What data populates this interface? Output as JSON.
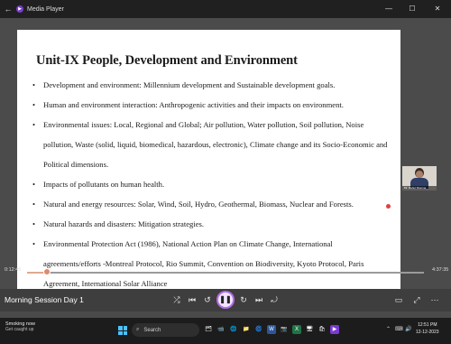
{
  "window": {
    "title": "Media Player",
    "back_glyph": "←",
    "app_icon_glyph": "▶",
    "minimize_glyph": "—",
    "maximize_glyph": "☐",
    "close_glyph": "✕"
  },
  "slide": {
    "title": "Unit-IX People, Development and Environment",
    "bullets": [
      "Development and environment: Millennium development and Sustainable development goals.",
      "Human and environment interaction: Anthropogenic activities and their impacts on environment.",
      "Environmental issues: Local, Regional and Global; Air pollution, Water pollution, Soil pollution, Noise pollution, Waste (solid, liquid, biomedical, hazardous, electronic), Climate change and its Socio-Economic and Political dimensions.",
      "Impacts of pollutants on human health.",
      "Natural and energy resources: Solar, Wind, Soil, Hydro, Geothermal, Biomass, Nuclear and Forests.",
      "Natural hazards and disasters: Mitigation strategies.",
      "Environmental Protection Act (1986), National Action Plan on Climate Change, International agreements/efforts -Montreal Protocol, Rio Summit, Convention on Biodiversity, Kyoto Protocol, Paris Agreement, International Solar Alliance"
    ]
  },
  "webcam": {
    "caption": "Mr. Rahul Sharma"
  },
  "player": {
    "elapsed": "0:12:45",
    "total": "4:37:35",
    "progress_fraction": 0.05,
    "session_title": "Morning Session Day 1",
    "icons": {
      "shuffle": "⤮",
      "prev": "⏮",
      "rewind": "↺",
      "pause": "❚❚",
      "forward": "↻",
      "next": "⏭",
      "repeat": "⤾",
      "cast": "▭",
      "fullscreen": "⤢",
      "more": "⋯"
    }
  },
  "taskbar": {
    "weather_line1": "Smoking now",
    "weather_line2": "Get caught up",
    "search_placeholder": "Search",
    "search_icon": "⌕",
    "apps": [
      "🗂",
      "📹",
      "🌐",
      "📁",
      "🌀",
      "W",
      "📷",
      "X",
      "🖥",
      "🛍",
      "▶"
    ],
    "tray_icons": [
      "⌃",
      "⌨",
      "🔊"
    ],
    "time": "12:51 PM",
    "date": "12-12-2023"
  },
  "colors": {
    "accent": "#b46ee6",
    "progress": "#e08a6a",
    "slide_bg": "#ffffff",
    "video_bg": "#4b4b4b"
  }
}
